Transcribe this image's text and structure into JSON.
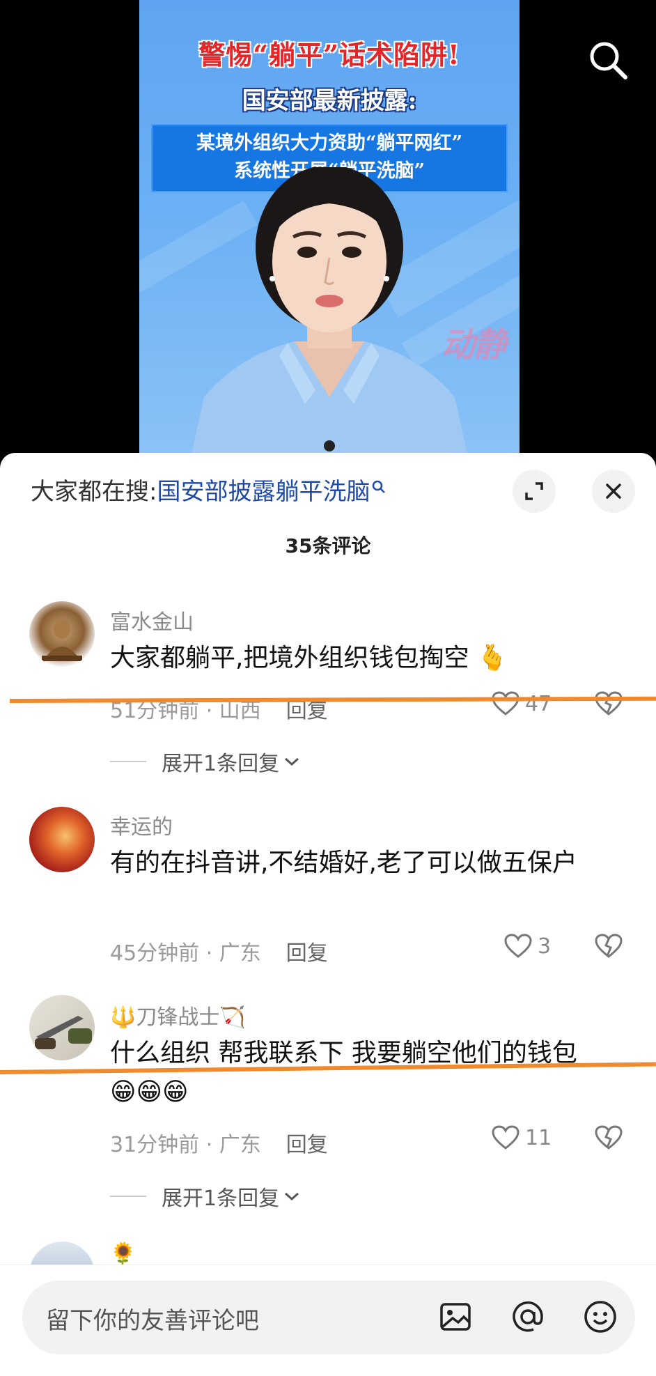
{
  "video": {
    "headline_line1": "警惕“躺平”话术陷阱!",
    "headline_line2": "国安部最新披露:",
    "headline_line3": "某境外组织大力资助“躺平网红”",
    "headline_line4": "系统性开展“躺平洗脑”",
    "watermark": "动静"
  },
  "sheet": {
    "trending_label": "大家都在搜:",
    "trending_keyword": "国安部披露躺平洗脑",
    "comment_count": "35条评论"
  },
  "comments": [
    {
      "username": "富水金山",
      "text": "大家都躺平,把境外组织钱包掏空",
      "emoji": "🫰",
      "time": "51分钟前",
      "location": "山西",
      "reply_label": "回复",
      "likes": "47",
      "expand_label": "展开1条回复"
    },
    {
      "username": "幸运的",
      "text": "有的在抖音讲,不结婚好,老了可以做五保户",
      "time": "45分钟前",
      "location": "广东",
      "reply_label": "回复",
      "likes": "3"
    },
    {
      "username": "刀锋战士",
      "username_prefix": "🔱",
      "username_suffix": "🏹",
      "text": "什么组织 帮我联系下 我要躺空他们的钱包",
      "emoji": "😁😁😁",
      "time": "31分钟前",
      "location": "广东",
      "reply_label": "回复",
      "likes": "11",
      "expand_label": "展开1条回复"
    },
    {
      "username": "🌻"
    }
  ],
  "input": {
    "placeholder": "留下你的友善评论吧"
  },
  "colors": {
    "accent_link": "#1f4aa8",
    "headline_red": "#e3262a",
    "headline_box": "#1676e2",
    "strike_orange": "#f08a2f"
  },
  "icons": [
    "search-icon",
    "expand-icon",
    "close-icon",
    "heart-icon",
    "broken-heart-icon",
    "chevron-down-icon",
    "image-icon",
    "at-icon",
    "emoji-icon"
  ]
}
